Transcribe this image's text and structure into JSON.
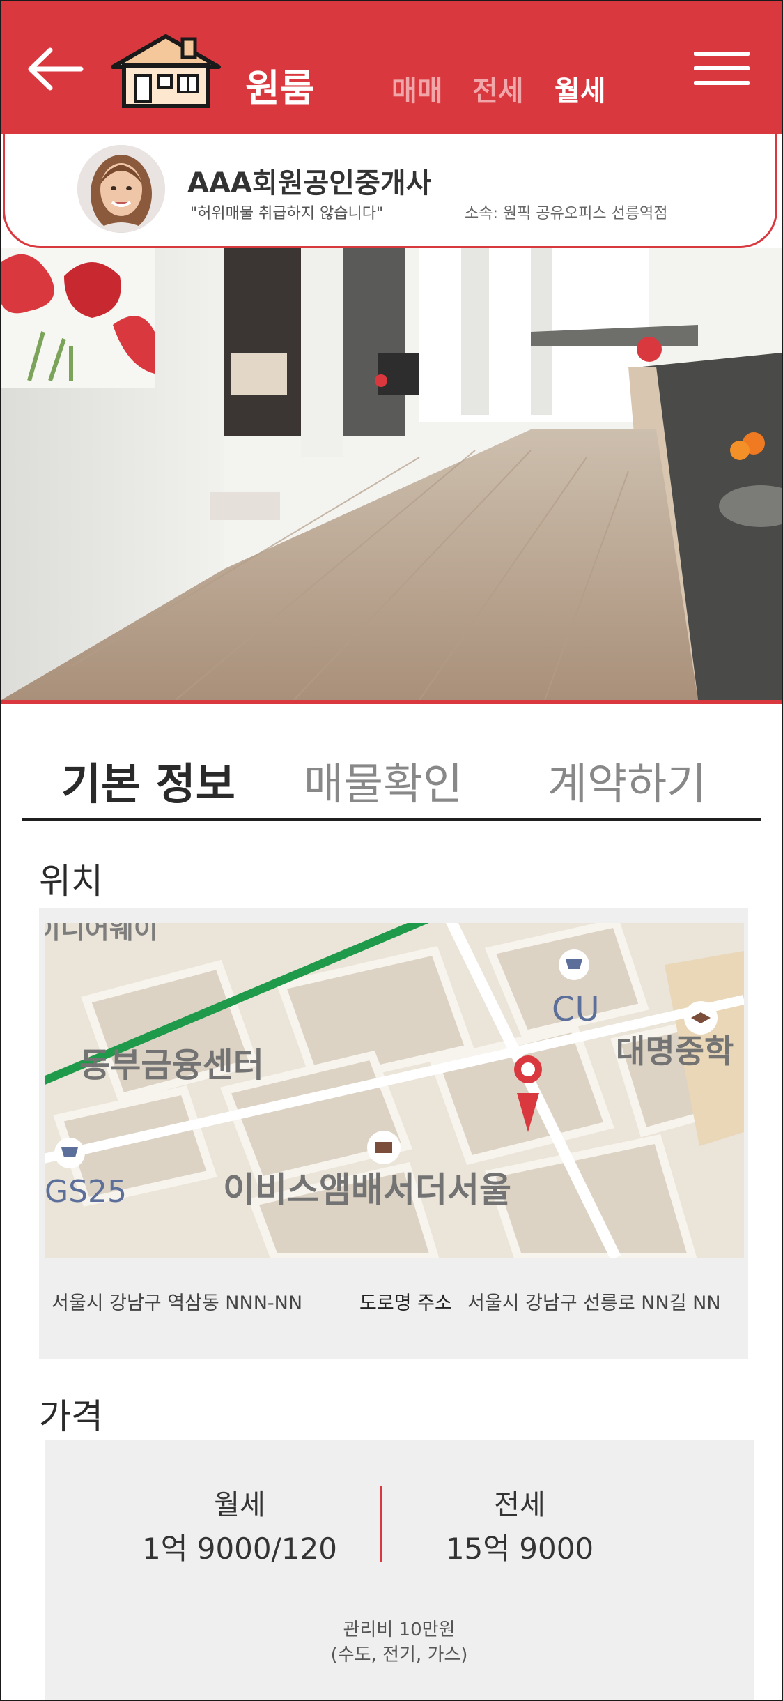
{
  "header": {
    "title": "원룸",
    "deal_types": [
      "매매",
      "전세",
      "월세"
    ],
    "active_deal": "월세"
  },
  "agent": {
    "name": "AAA회원공인중개사",
    "slogan": "\"허위매물 취급하지 않습니다\"",
    "affiliation": "소속: 원픽 공유오피스 선릉역점"
  },
  "tabs": [
    "기본 정보",
    "매물확인",
    "계약하기"
  ],
  "location": {
    "heading": "위치",
    "map_labels": {
      "subway": "서울 지하철 이니어웨이",
      "cu": "CU",
      "finance_center": "동부금융센터",
      "school": "대명중학",
      "gs25": "GS25",
      "hotel": "이비스앰배서더서울"
    },
    "lot_address": "서울시 강남구 역삼동 NNN-NN",
    "road_label": "도로명 주소",
    "road_address": "서울시 강남구 선릉로 NN길 NN"
  },
  "price": {
    "heading": "가격",
    "monthly_label": "월세",
    "monthly_value": "1억 9000/120",
    "jeonse_label": "전세",
    "jeonse_value": "15억 9000",
    "fee_line1": "관리비  10만원",
    "fee_line2": "(수도, 전기, 가스)"
  },
  "colors": {
    "brand_red": "#d9383e",
    "map_route": "#1e9a4a"
  }
}
